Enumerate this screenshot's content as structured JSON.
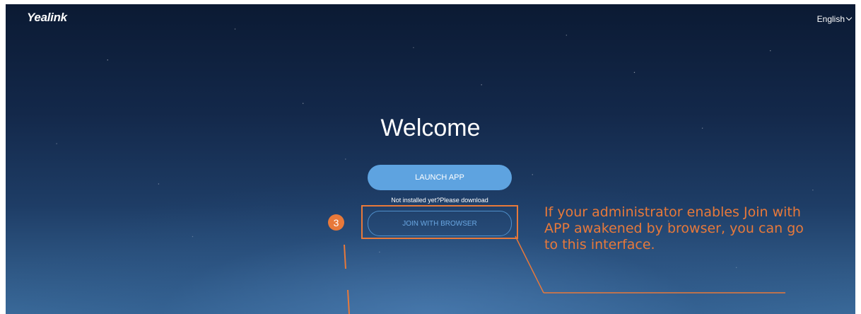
{
  "header": {
    "logo_text": "Yealink",
    "language_label": "English"
  },
  "main": {
    "welcome_title": "Welcome",
    "launch_button_label": "LAUNCH APP",
    "not_installed_text": "Not installed yet?Please download",
    "join_browser_button_label": "JOIN WITH BROWSER"
  },
  "annotation": {
    "step_number": "3",
    "callout_text": "If your administrator enables Join with APP awakened by browser, you can go to this interface.",
    "accent_color": "#e8793a"
  },
  "colors": {
    "launch_button": "#5ea3e0",
    "join_button_border": "#4f8fcb",
    "background_dark": "#0b1a33",
    "background_light": "#3a6a9a"
  }
}
